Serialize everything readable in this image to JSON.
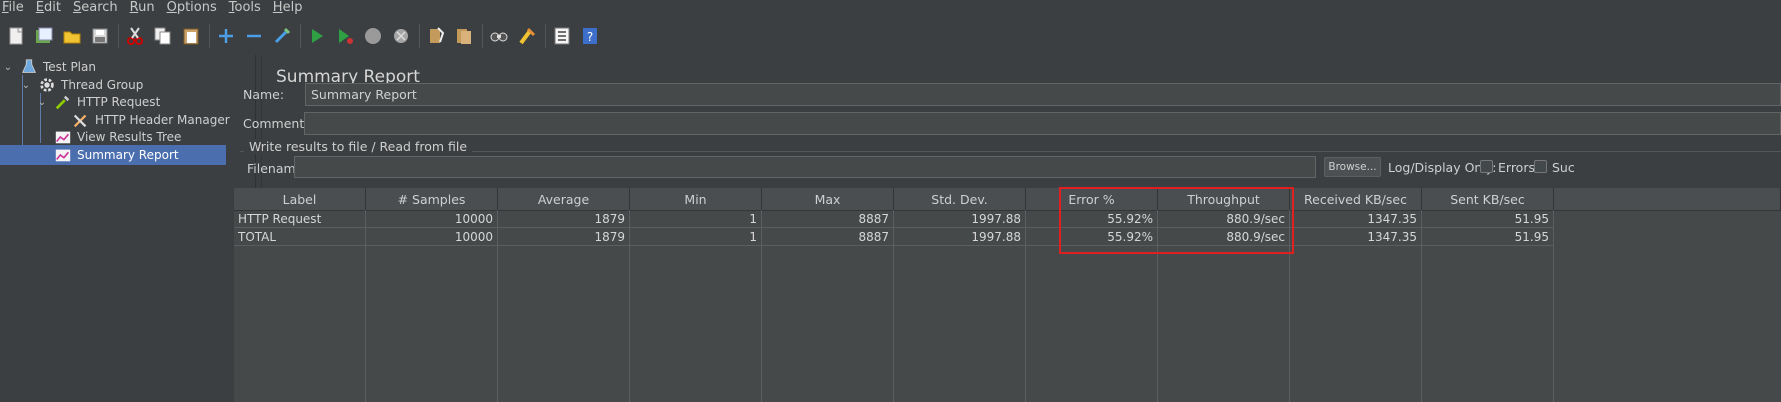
{
  "menu": [
    {
      "mnemonic": "F",
      "rest": "ile"
    },
    {
      "mnemonic": "E",
      "rest": "dit"
    },
    {
      "mnemonic": "S",
      "rest": "earch"
    },
    {
      "mnemonic": "R",
      "rest": "un"
    },
    {
      "mnemonic": "O",
      "rest": "ptions"
    },
    {
      "mnemonic": "T",
      "rest": "ools"
    },
    {
      "mnemonic": "H",
      "rest": "elp"
    }
  ],
  "toolbar": {
    "icons": [
      "new-icon",
      "templates-icon",
      "open-icon",
      "save-icon",
      "cut-icon",
      "copy-icon",
      "paste-icon",
      "expand-icon",
      "collapse-icon",
      "toggle-icon",
      "start-icon",
      "start-no-pauses-icon",
      "stop-icon",
      "shutdown-icon",
      "clear-icon",
      "clear-all-icon",
      "search-icon",
      "reset-search-icon",
      "function-helper-icon",
      "help-icon"
    ]
  },
  "tree": {
    "items": [
      {
        "label": "Test Plan",
        "icon": "flask-icon",
        "level": 0,
        "expanded": true
      },
      {
        "label": "Thread Group",
        "icon": "gear-icon",
        "level": 1,
        "expanded": true
      },
      {
        "label": "HTTP Request",
        "icon": "pipette-icon",
        "level": 2,
        "expanded": true
      },
      {
        "label": "HTTP Header Manager",
        "icon": "wrench-icon",
        "level": 3
      },
      {
        "label": "View Results Tree",
        "icon": "chart-icon",
        "level": 2
      },
      {
        "label": "Summary Report",
        "icon": "chart-icon",
        "level": 2,
        "selected": true
      }
    ]
  },
  "panel": {
    "title": "Summary Report",
    "name_label": "Name:",
    "name_value": "Summary Report",
    "comments_label": "Comments:",
    "comments_value": "",
    "write_legend": "Write results to file / Read from file",
    "filename_label": "Filename",
    "filename_value": "",
    "browse_label": "Browse...",
    "log_display_label": "Log/Display Only:",
    "errors_label": "Errors",
    "successes_label": "Suc"
  },
  "table": {
    "headers": [
      "Label",
      "# Samples",
      "Average",
      "Min",
      "Max",
      "Std. Dev.",
      "Error %",
      "Throughput",
      "Received KB/sec",
      "Sent KB/sec"
    ],
    "rows": [
      [
        "HTTP Request",
        "10000",
        "1879",
        "1",
        "8887",
        "1997.88",
        "55.92%",
        "880.9/sec",
        "1347.35",
        "51.95"
      ],
      [
        "TOTAL",
        "10000",
        "1879",
        "1",
        "8887",
        "1997.88",
        "55.92%",
        "880.9/sec",
        "1347.35",
        "51.95"
      ]
    ]
  },
  "colors": {
    "accent_selection": "#4b6eaf",
    "highlight_box": "#e02020"
  }
}
